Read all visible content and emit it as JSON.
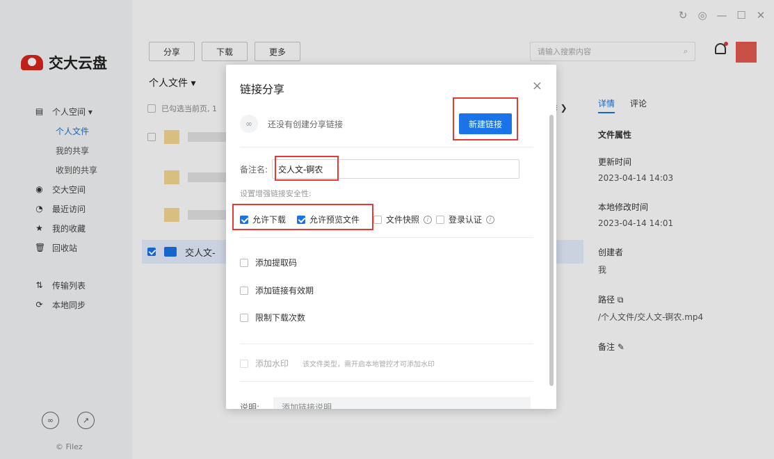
{
  "window": {
    "refresh": "↻",
    "settings": "◎",
    "minimize": "—",
    "maximize": "☐",
    "close": "✕"
  },
  "app": {
    "logo_text": "交大云盘",
    "copyright": "© Filez"
  },
  "sidebar": {
    "items": [
      {
        "label": "个人空间 ▾",
        "icon": "document-icon"
      },
      {
        "label": "个人文件",
        "sub": true,
        "active": true
      },
      {
        "label": "我的共享",
        "sub": true
      },
      {
        "label": "收到的共享",
        "sub": true
      },
      {
        "label": "交大空间",
        "icon": "org-icon"
      },
      {
        "label": "最近访问",
        "icon": "clock-icon"
      },
      {
        "label": "我的收藏",
        "icon": "star-icon"
      },
      {
        "label": "回收站",
        "icon": "trash-icon"
      },
      {
        "label": "传输列表",
        "icon": "transfer-icon"
      },
      {
        "label": "本地同步",
        "icon": "sync-icon"
      }
    ]
  },
  "toolbar": {
    "share": "分享",
    "download": "下载",
    "more": "更多"
  },
  "search": {
    "placeholder": "请输入搜索内容"
  },
  "breadcrumb": "个人文件 ▾",
  "table": {
    "header_text": "已勾选当前页, 1",
    "selected_file": "交人文-"
  },
  "details": {
    "tab_details": "详情",
    "tab_comments": "评论",
    "file_props": "文件属性",
    "updated_label": "更新时间",
    "updated_value": "2023-04-14 14:03",
    "local_mod_label": "本地修改时间",
    "local_mod_value": "2023-04-14 14:01",
    "creator_label": "创建者",
    "creator_value": "我",
    "path_label": "路径",
    "path_value": "/个人文件/交人文-锕农.mp4",
    "note_label": "备注"
  },
  "modal": {
    "title": "链接分享",
    "close": "×",
    "no_link": "还没有创建分享链接",
    "new_link": "新建链接",
    "remark_label": "备注名:",
    "remark_value": "交人文-锕农",
    "security_label": "设置增强链接安全性:",
    "allow_download": "允许下载",
    "allow_preview": "允许预览文件",
    "snapshot": "文件快照",
    "login_auth": "登录认证",
    "add_code": "添加提取码",
    "add_expiry": "添加链接有效期",
    "limit_downloads": "限制下载次数",
    "add_watermark": "添加水印",
    "watermark_hint": "该文件类型，需开启本地管控才可添加水印",
    "desc_label": "说明:",
    "desc_placeholder": "添加链接说明"
  }
}
